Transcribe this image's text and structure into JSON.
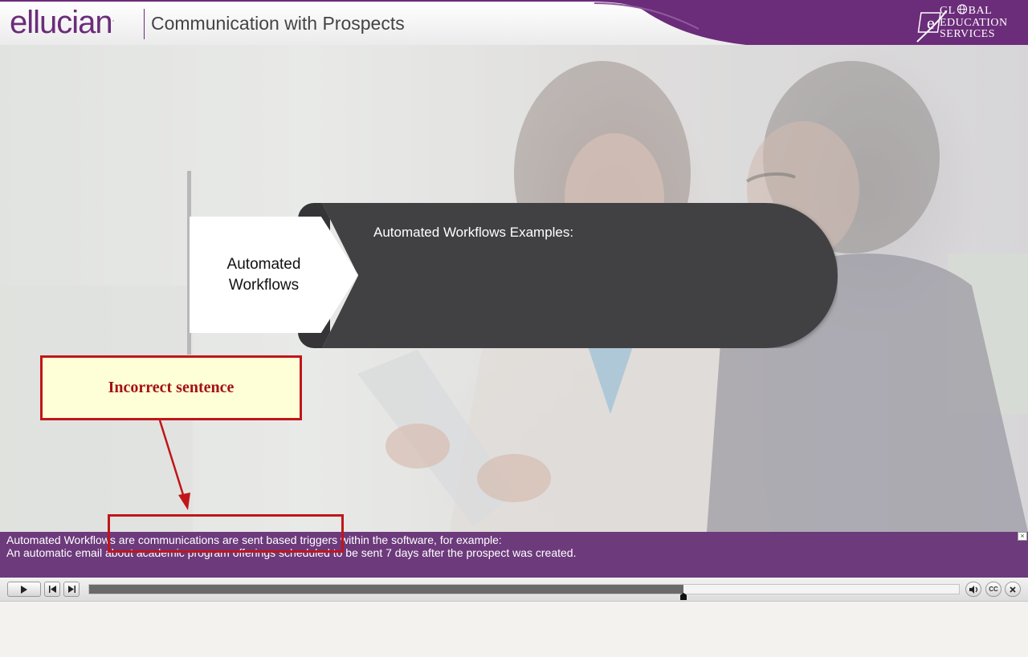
{
  "header": {
    "logo_text": "ellucian",
    "logo_tm": ".",
    "title": "Communication with Prospects",
    "brand_badge": {
      "line1": "GL",
      "line1_suffix": "BAL",
      "line2": "EDUCATION",
      "line3": "SERVICES"
    },
    "colors": {
      "brand": "#6b2c7a"
    }
  },
  "slide": {
    "tab_label_line1": "Automated",
    "tab_label_line2": "Workflows",
    "panel_title": "Automated Workflows Examples:"
  },
  "annotation": {
    "note": "Incorrect sentence",
    "color": "#c0161a",
    "fill": "#ffffd7"
  },
  "caption": {
    "line1": "Automated Workflows are communications are sent based triggers within the software, for example:",
    "line2": "An automatic email about academic program offerings scheduled to be sent 7 days after the prospect was created.",
    "close_label": "×"
  },
  "player": {
    "progress_fraction": 0.683,
    "buttons": [
      "play-icon",
      "previous-icon",
      "next-icon",
      "volume-icon",
      "closed-captions-icon",
      "exit-icon"
    ],
    "cc_label": "CC"
  }
}
